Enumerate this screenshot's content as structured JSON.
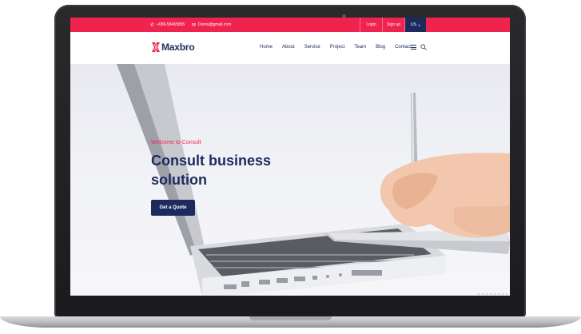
{
  "topbar": {
    "phone": "+099-58465855",
    "email": "Demo@gmail.com",
    "login": "Login",
    "signup": "Sign up",
    "lang": "US",
    "accent": "#f0234f"
  },
  "header": {
    "logo": "Maxbro",
    "nav": [
      "Home",
      "About",
      "Service",
      "Project",
      "Team",
      "Blog",
      "Contact"
    ]
  },
  "hero": {
    "eyebrow": "Welcome to Consult",
    "title_line1": "Consult business",
    "title_line2": "solution",
    "button": "Get a Quote"
  },
  "colors": {
    "primary": "#1c2b5e",
    "accent": "#f0234f"
  },
  "icons": [
    "phone-icon",
    "mail-icon",
    "chevron-down-icon",
    "menu-icon",
    "search-icon",
    "logo-icon"
  ]
}
